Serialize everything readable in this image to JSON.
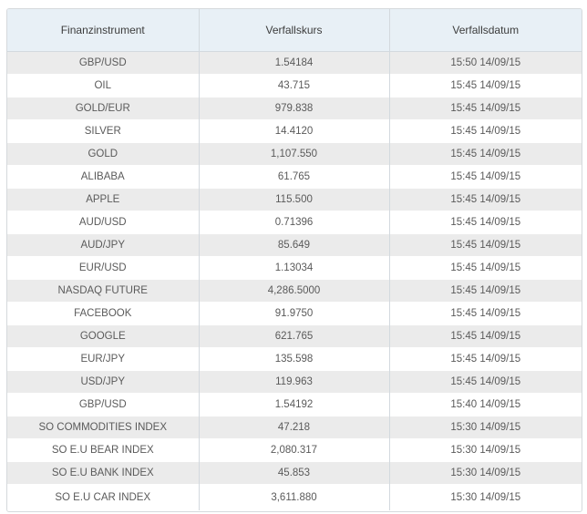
{
  "table": {
    "headers": [
      "Finanzinstrument",
      "Verfallskurs",
      "Verfallsdatum"
    ],
    "rows": [
      {
        "instrument": "GBP/USD",
        "price": "1.54184",
        "date": "15:50 14/09/15"
      },
      {
        "instrument": "OIL",
        "price": "43.715",
        "date": "15:45 14/09/15"
      },
      {
        "instrument": "GOLD/EUR",
        "price": "979.838",
        "date": "15:45 14/09/15"
      },
      {
        "instrument": "SILVER",
        "price": "14.4120",
        "date": "15:45 14/09/15"
      },
      {
        "instrument": "GOLD",
        "price": "1,107.550",
        "date": "15:45 14/09/15"
      },
      {
        "instrument": "ALIBABA",
        "price": "61.765",
        "date": "15:45 14/09/15"
      },
      {
        "instrument": "APPLE",
        "price": "115.500",
        "date": "15:45 14/09/15"
      },
      {
        "instrument": "AUD/USD",
        "price": "0.71396",
        "date": "15:45 14/09/15"
      },
      {
        "instrument": "AUD/JPY",
        "price": "85.649",
        "date": "15:45 14/09/15"
      },
      {
        "instrument": "EUR/USD",
        "price": "1.13034",
        "date": "15:45 14/09/15"
      },
      {
        "instrument": "NASDAQ FUTURE",
        "price": "4,286.5000",
        "date": "15:45 14/09/15"
      },
      {
        "instrument": "FACEBOOK",
        "price": "91.9750",
        "date": "15:45 14/09/15"
      },
      {
        "instrument": "GOOGLE",
        "price": "621.765",
        "date": "15:45 14/09/15"
      },
      {
        "instrument": "EUR/JPY",
        "price": "135.598",
        "date": "15:45 14/09/15"
      },
      {
        "instrument": "USD/JPY",
        "price": "119.963",
        "date": "15:45 14/09/15"
      },
      {
        "instrument": "GBP/USD",
        "price": "1.54192",
        "date": "15:40 14/09/15"
      },
      {
        "instrument": "SO COMMODITIES INDEX",
        "price": "47.218",
        "date": "15:30 14/09/15"
      },
      {
        "instrument": "SO E.U BEAR INDEX",
        "price": "2,080.317",
        "date": "15:30 14/09/15"
      },
      {
        "instrument": "SO E.U BANK INDEX",
        "price": "45.853",
        "date": "15:30 14/09/15"
      },
      {
        "instrument": "SO E.U CAR INDEX",
        "price": "3,611.880",
        "date": "15:30 14/09/15"
      }
    ]
  },
  "colors": {
    "header_bg": "#e8f0f6",
    "stripe_bg": "#ebebeb",
    "border": "#d3d9de",
    "text": "#5a5a5a"
  }
}
